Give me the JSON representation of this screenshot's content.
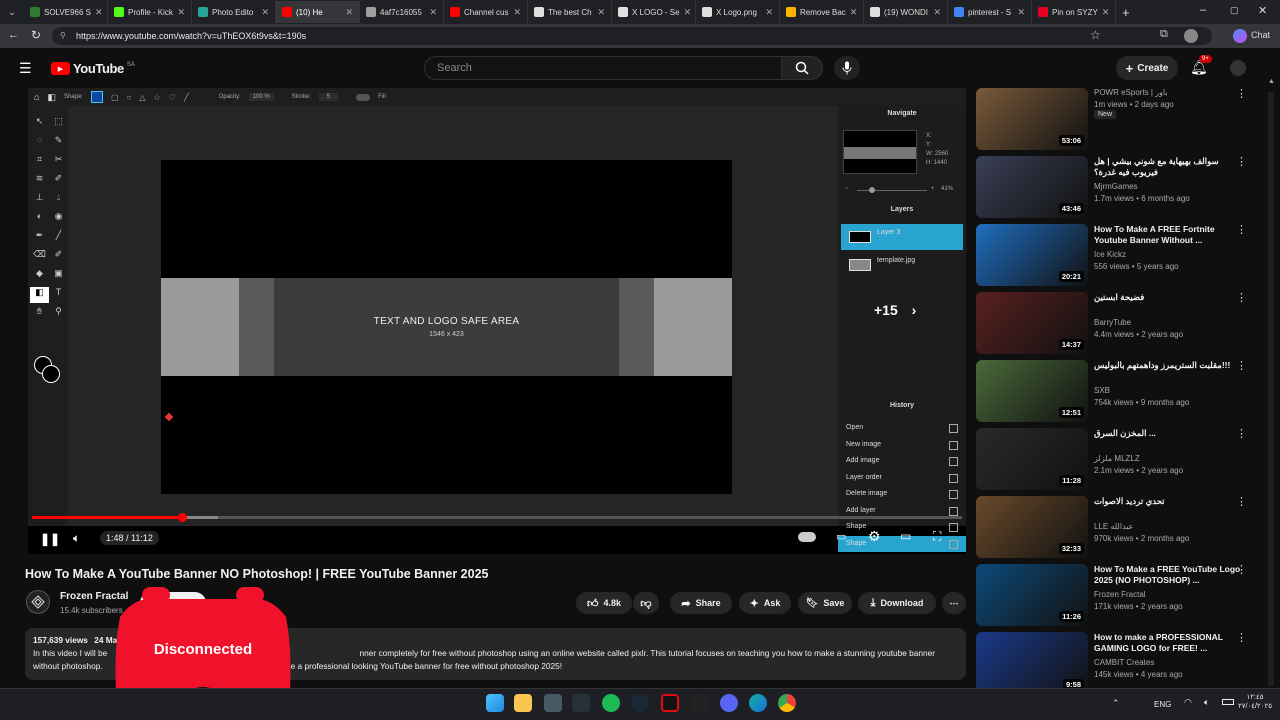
{
  "browser": {
    "tabs": [
      {
        "label": "SOLVE966 S",
        "color": "#2e7d32"
      },
      {
        "label": "Profile - Kick",
        "color": "#53fc18"
      },
      {
        "label": "Photo Edito",
        "color": "#26a69a"
      },
      {
        "label": "(10) He",
        "color": "#ff0000",
        "active": true
      },
      {
        "label": "4af7c16055",
        "color": "#9e9e9e"
      },
      {
        "label": "Channel cus",
        "color": "#ff0000"
      },
      {
        "label": "The best Ch",
        "color": "#e0e0e0"
      },
      {
        "label": "X LOGO - Se",
        "color": "#e0e0e0"
      },
      {
        "label": "X Logo.png",
        "color": "#e0e0e0"
      },
      {
        "label": "Remove Bac",
        "color": "#ffb300"
      },
      {
        "label": "(19) WONDI",
        "color": "#e0e0e0"
      },
      {
        "label": "pinterest - S",
        "color": "#4285f4"
      },
      {
        "label": "Pin on SYZY",
        "color": "#e60023"
      }
    ],
    "url": "https://www.youtube.com/watch?v=uThEOX6t9vs&t=190s"
  },
  "youtube": {
    "logo_text": "YouTube",
    "logo_region": "SA",
    "search_placeholder": "Search",
    "create_label": "Create",
    "notif_count": "9+"
  },
  "pixlr": {
    "shape_label": "Shape:",
    "opacity_label": "Opacity:",
    "opacity_value": "100 %",
    "stroke_label": "Stroke:",
    "stroke_value": "5",
    "fill_label": "Fill",
    "navigate_title": "Navigate",
    "nav_x": "X:",
    "nav_y": "Y:",
    "nav_w": "W: 2560",
    "nav_h": "H: 1440",
    "zoom_value": "41%",
    "layers_title": "Layers",
    "layers": [
      "Layer 3",
      "template.jpg"
    ],
    "layers_more": "+15",
    "history_title": "History",
    "history": [
      "Open",
      "New image",
      "Add image",
      "Layer order",
      "Delete image",
      "Add layer",
      "Shape",
      "Shape"
    ],
    "safe_area_title": "TEXT AND LOGO SAFE AREA",
    "safe_area_dims": "1546 x 423",
    "canvas_info": "2560 x 1440 px @ 41%"
  },
  "player": {
    "time_current": "1:48",
    "time_total": "11:12",
    "progress": 0.161,
    "buffered": 0.2
  },
  "video": {
    "title": "How To Make A YouTube Banner NO Photoshop! | FREE YouTube Banner 2025",
    "channel": "Frozen Fractal",
    "subscribers": "15.4k subscribers",
    "subscribe_label": "Subscribe",
    "likes": "4.8k",
    "share_label": "Share",
    "ask_label": "Ask",
    "save_label": "Save",
    "download_label": "Download",
    "views": "157,639 views",
    "date_partial": "24 Ma",
    "desc_line1_a": "In this video I will be",
    "desc_line1_b": "nner completely for free without photoshop using an online website called pixlr. This tutorial focuses on teaching you how to make a stunning youtube banner",
    "desc_line2_a": "without photoshop.",
    "desc_line2_b": "make a professional looking YouTube banner for free without photoshop 2025!"
  },
  "overlay": {
    "disconnected_label": "Disconnected"
  },
  "recommendations": [
    {
      "title": "",
      "channel": "POWR eSports | باور",
      "meta": "1m views • 2 days ago",
      "badge": "New",
      "duration": "53:06",
      "color": "#7a5a3a"
    },
    {
      "title": "سوالف بهيهاية مع شوني بيشي | هل فيريوب فيه غدرة؟",
      "channel": "MjrmGames",
      "meta": "1.7m views • 6 months ago",
      "duration": "43:46",
      "color": "#3a3f55"
    },
    {
      "title": "How To Make A FREE Fortnite Youtube Banner Without ...",
      "channel": "Ice Kickz",
      "meta": "556 views • 5 years ago",
      "duration": "20:21",
      "color": "#1f6fc0"
    },
    {
      "title": "فضيحة ابستين",
      "channel": "BarryTube",
      "meta": "4.4m views • 2 years ago",
      "duration": "14:37",
      "color": "#5a2020"
    },
    {
      "title": "مقلبت الستريمرز وداهمتهم بالبوليس!!!",
      "channel": "SXB",
      "meta": "754k views • 9 months ago",
      "duration": "12:51",
      "color": "#4a6a3a"
    },
    {
      "title": "المخزن السرق ...",
      "channel": "ملزلز MLZLZ",
      "meta": "2.1m views • 2 years ago",
      "duration": "11:28",
      "color": "#2a2a2a"
    },
    {
      "title": "تحدي ترديد الاصوات",
      "channel": "LLE عبدالله",
      "meta": "970k views • 2 months ago",
      "duration": "32:33",
      "color": "#6a4a2a"
    },
    {
      "title": "How To Make a FREE YouTube Logo 2025 (NO PHOTOSHOP) ...",
      "channel": "Frozen Fractal",
      "meta": "171k views • 2 years ago",
      "duration": "11:26",
      "color": "#0d4a7a"
    },
    {
      "title": "How to make a PROFESSIONAL GAMING LOGO for FREE! ...",
      "channel": "CAMBIT Creates",
      "meta": "145k views • 4 years ago",
      "duration": "9:58",
      "color": "#1a3a8a"
    }
  ],
  "taskbar": {
    "lang": "ENG",
    "time": "١٢:٤٥",
    "date": "٢٧/٠٤/٢٠٢٥"
  }
}
